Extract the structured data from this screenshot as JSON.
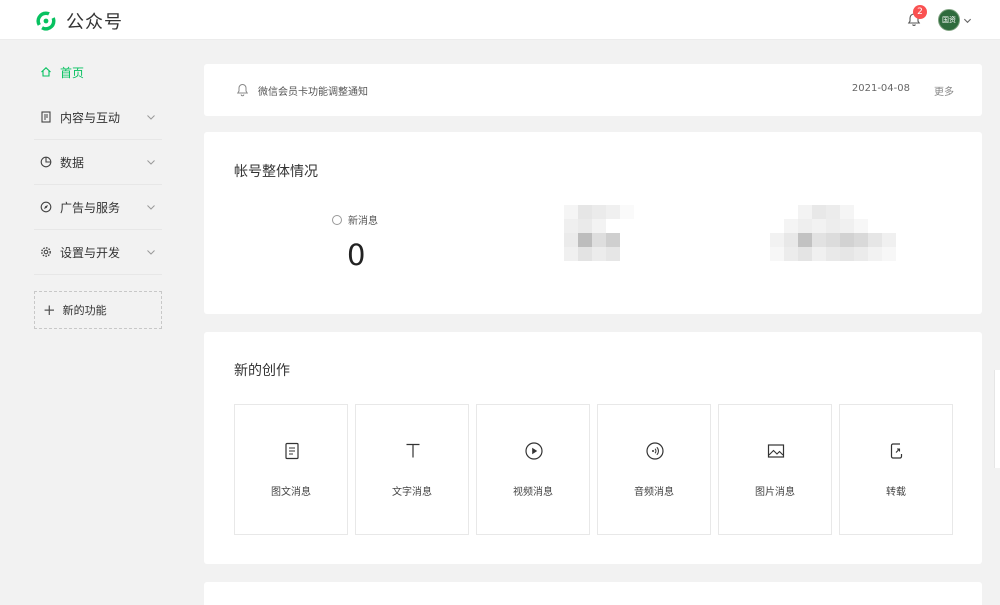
{
  "brand": {
    "name": "公众号",
    "logo_icon": "wechat-official-accounts-logo",
    "color": "#07c160"
  },
  "header": {
    "notification_count": "2",
    "avatar_text": "国资"
  },
  "sidebar": {
    "items": [
      {
        "label": "首页",
        "icon": "home-icon",
        "active": true
      },
      {
        "label": "内容与互动",
        "icon": "document-icon"
      },
      {
        "label": "数据",
        "icon": "pie-chart-icon"
      },
      {
        "label": "广告与服务",
        "icon": "compass-icon"
      },
      {
        "label": "设置与开发",
        "icon": "gear-icon"
      }
    ],
    "new_function": {
      "label": "新的功能"
    }
  },
  "notice": {
    "text": "微信会员卡功能调整通知",
    "date": "2021-04-08",
    "more": "更多"
  },
  "overview": {
    "title": "帐号整体情况",
    "stats": [
      {
        "label": "新消息",
        "value": "0"
      }
    ]
  },
  "create": {
    "title": "新的创作",
    "tiles": [
      {
        "label": "图文消息",
        "icon": "article-icon"
      },
      {
        "label": "文字消息",
        "icon": "text-icon"
      },
      {
        "label": "视频消息",
        "icon": "video-play-icon"
      },
      {
        "label": "音频消息",
        "icon": "audio-icon"
      },
      {
        "label": "图片消息",
        "icon": "image-icon"
      },
      {
        "label": "转载",
        "icon": "repost-icon"
      }
    ]
  }
}
